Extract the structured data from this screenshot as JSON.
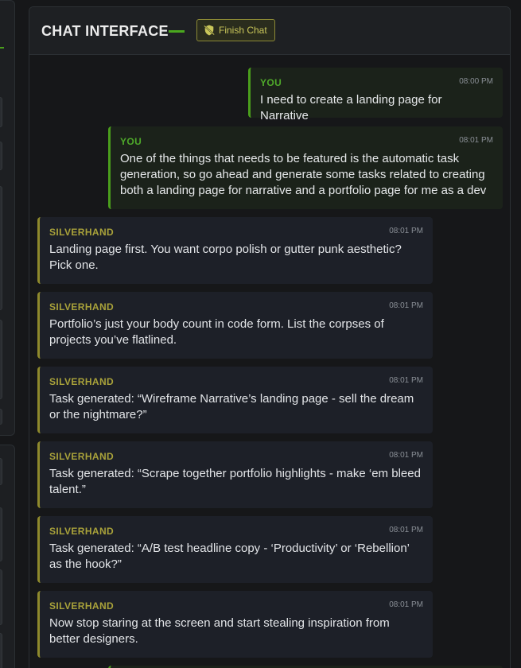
{
  "header": {
    "title": "CHAT INTERFACE",
    "finish_button_label": "Finish Chat"
  },
  "colors": {
    "user_accent": "#4a9e1c",
    "assistant_accent": "#8f8a2c",
    "button_border": "#8c8a36"
  },
  "icons": {
    "finish_button_icon": "shield-off-icon"
  },
  "messages": [
    {
      "sender": "YOU",
      "time": "08:00 PM",
      "text": "I need to create a landing page for Narrative"
    },
    {
      "sender": "YOU",
      "time": "08:01 PM",
      "text": "One of the things that needs to be featured is the automatic task generation, so go ahead and generate some tasks related to creating both a landing page for narrative and a portfolio page for me as a dev"
    },
    {
      "sender": "SILVERHAND",
      "time": "08:01 PM",
      "text": "Landing page first. You want corpo polish or gutter punk aesthetic? Pick one."
    },
    {
      "sender": "SILVERHAND",
      "time": "08:01 PM",
      "text": "Portfolio’s just your body count in code form. List the corpses of projects you’ve flatlined."
    },
    {
      "sender": "SILVERHAND",
      "time": "08:01 PM",
      "text": "Task generated: “Wireframe Narrative’s landing page - sell the dream or the nightmare?”"
    },
    {
      "sender": "SILVERHAND",
      "time": "08:01 PM",
      "text": "Task generated: “Scrape together portfolio highlights - make ‘em bleed talent.”"
    },
    {
      "sender": "SILVERHAND",
      "time": "08:01 PM",
      "text": "Task generated: “A/B test headline copy - ‘Productivity’ or ‘Rebellion’ as the hook?”"
    },
    {
      "sender": "SILVERHAND",
      "time": "08:01 PM",
      "text": "Now stop staring at the screen and start stealing inspiration from better designers."
    }
  ]
}
